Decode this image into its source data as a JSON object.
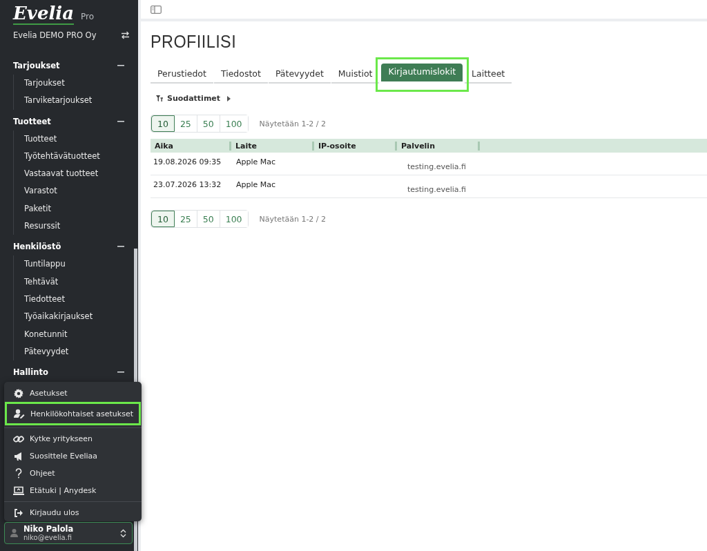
{
  "sidebar": {
    "logo": "Evelia",
    "edition": "Pro",
    "company": "Evelia DEMO PRO Oy",
    "groups": [
      {
        "title": "Tarjoukset",
        "expanded": true,
        "items": [
          "Tarjoukset",
          "Tarviketarjoukset"
        ]
      },
      {
        "title": "Tuotteet",
        "expanded": true,
        "items": [
          "Tuotteet",
          "Työtehtävätuotteet",
          "Vastaavat tuotteet",
          "Varastot",
          "Paketit",
          "Resurssit"
        ]
      },
      {
        "title": "Henkilöstö",
        "expanded": true,
        "items": [
          "Tuntilappu",
          "Tehtävät",
          "Tiedotteet",
          "Työaikakirjaukset",
          "Konetunnit",
          "Pätevyydet"
        ]
      },
      {
        "title": "Hallinto",
        "expanded": true
      }
    ],
    "user_menu": {
      "items": [
        {
          "kind": "gear",
          "label": "Asetukset",
          "highlighted": false
        },
        {
          "kind": "user-edit",
          "label": "Henkilökohtaiset asetukset",
          "highlighted": true
        },
        {
          "kind": "link",
          "label": "Kytke yritykseen",
          "highlighted": false
        },
        {
          "kind": "megaphone",
          "label": "Suosittele Eveliaa",
          "highlighted": false
        },
        {
          "kind": "question",
          "label": "Ohjeet",
          "highlighted": false
        },
        {
          "kind": "laptop",
          "label": "Etätuki | Anydesk",
          "highlighted": false
        },
        {
          "kind": "logout",
          "label": "Kirjaudu ulos",
          "highlighted": false
        }
      ]
    },
    "user": {
      "name": "Niko Palola",
      "email": "niko@evelia.fi"
    }
  },
  "page": {
    "title": "PROFIILISI",
    "tabs": [
      {
        "label": "Perustiedot",
        "selected": false,
        "highlighted": false
      },
      {
        "label": "Tiedostot",
        "selected": false,
        "highlighted": false
      },
      {
        "label": "Pätevyydet",
        "selected": false,
        "highlighted": false
      },
      {
        "label": "Muistiot",
        "selected": false,
        "highlighted": false
      },
      {
        "label": "Kirjautumislokit",
        "selected": true,
        "highlighted": true
      },
      {
        "label": "Laitteet",
        "selected": false,
        "highlighted": false
      }
    ],
    "filters": "Suodattimet",
    "page_sizes_top": [
      {
        "label": "10",
        "selected": true
      },
      {
        "label": "25",
        "selected": false
      },
      {
        "label": "50",
        "selected": false
      },
      {
        "label": "100",
        "selected": false
      }
    ],
    "showing_top": "Näytetään 1-2 / 2",
    "table": {
      "columns": [
        "Aika",
        "Laite",
        "IP-osoite",
        "Palvelin"
      ],
      "rows": [
        {
          "time": "19.08.2026 09:35",
          "device": "Apple Mac",
          "server": "testing.evelia.fi"
        },
        {
          "time": "23.07.2026 13:32",
          "device": "Apple Mac",
          "server": "testing.evelia.fi"
        }
      ]
    },
    "page_sizes_bottom": [
      {
        "label": "10",
        "selected": true
      },
      {
        "label": "25",
        "selected": false
      },
      {
        "label": "50",
        "selected": false
      },
      {
        "label": "100",
        "selected": false
      }
    ],
    "showing_bottom": "Näytetään 1-2 / 2"
  }
}
